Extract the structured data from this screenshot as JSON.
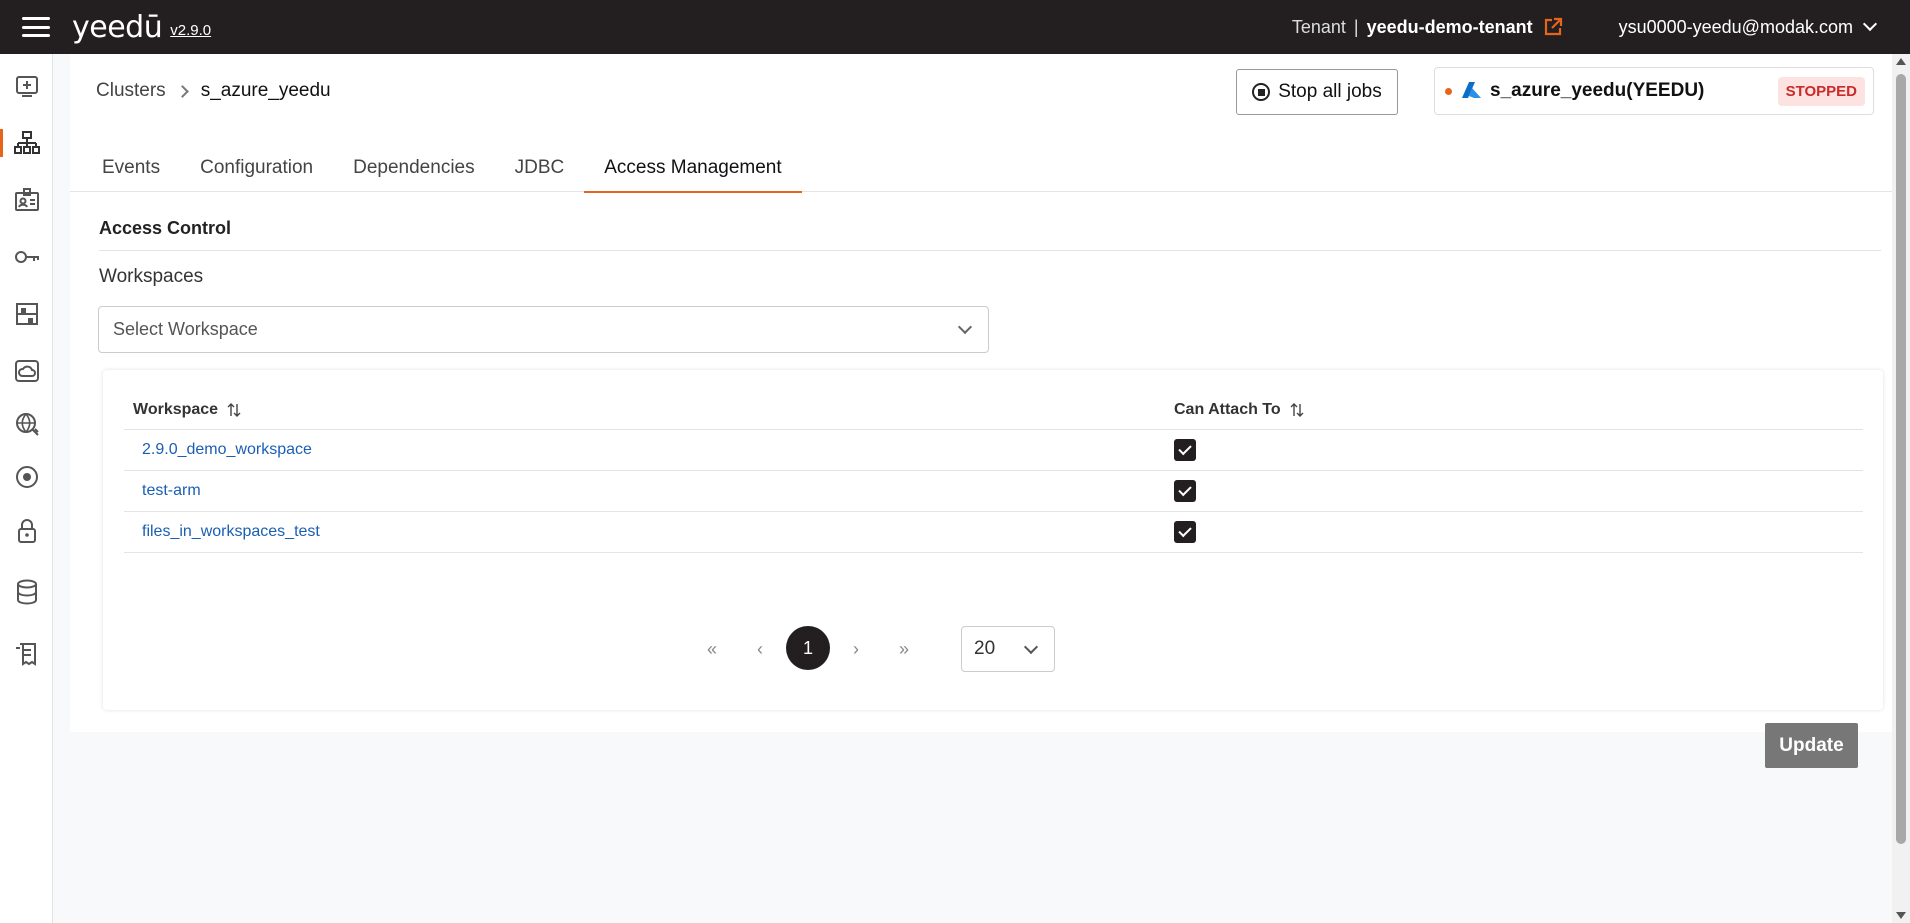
{
  "header": {
    "logo": "yeedū",
    "version": "v2.9.0",
    "tenant_label": "Tenant",
    "tenant_separator": "|",
    "tenant_name": "yeedu-demo-tenant",
    "user_email": "ysu0000-yeedu@modak.com"
  },
  "breadcrumb": {
    "parent": "Clusters",
    "current": "s_azure_yeedu"
  },
  "actions": {
    "stop_all_jobs": "Stop all jobs",
    "update": "Update"
  },
  "cluster_card": {
    "name": "s_azure_yeedu(YEEDU)",
    "status": "STOPPED"
  },
  "tabs": [
    {
      "label": "Events"
    },
    {
      "label": "Configuration"
    },
    {
      "label": "Dependencies"
    },
    {
      "label": "JDBC"
    },
    {
      "label": "Access Management"
    }
  ],
  "access_control": {
    "title": "Access Control",
    "workspaces_label": "Workspaces",
    "select_placeholder": "Select Workspace"
  },
  "table": {
    "columns": [
      "Workspace",
      "Can Attach To"
    ],
    "rows": [
      {
        "workspace": "2.9.0_demo_workspace",
        "can_attach": true
      },
      {
        "workspace": "test-arm",
        "can_attach": true
      },
      {
        "workspace": "files_in_workspaces_test",
        "can_attach": true
      }
    ]
  },
  "pagination": {
    "first": "«",
    "prev": "‹",
    "current_page": "1",
    "next": "›",
    "last": "»",
    "page_size": "20"
  },
  "colors": {
    "accent": "#e8641b",
    "topbar": "#231f20",
    "link": "#1a5fb4",
    "status_stopped": "#c92a2a"
  }
}
